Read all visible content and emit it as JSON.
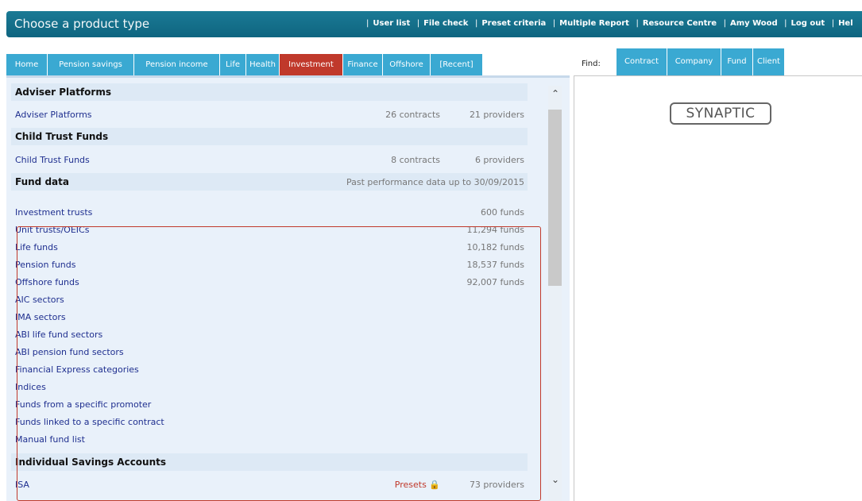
{
  "header": {
    "title": "Choose a product type",
    "links": [
      "User list",
      "File check",
      "Preset criteria",
      "Multiple Report",
      "Resource Centre",
      "Amy Wood",
      "Log out",
      "Hel"
    ]
  },
  "tabs": [
    "Home",
    "Pension savings",
    "Pension income",
    "Life",
    "Health",
    "Investment",
    "Finance",
    "Offshore",
    "[Recent]"
  ],
  "find": {
    "label": "Find:",
    "tabs": [
      "Contract",
      "Company",
      "Fund",
      "Client"
    ]
  },
  "logo": "SYNAPTIC",
  "sections": {
    "adviser": {
      "title": "Adviser Platforms",
      "item": "Adviser Platforms",
      "contracts": "26 contracts",
      "providers": "21 providers"
    },
    "ctf": {
      "title": "Child Trust Funds",
      "item": "Child Trust Funds",
      "contracts": "8 contracts",
      "providers": "6 providers"
    },
    "fund": {
      "title": "Fund data",
      "note": "Past performance data up to 30/09/2015",
      "items": [
        {
          "label": "Investment trusts",
          "count": "600 funds"
        },
        {
          "label": "Unit trusts/OEICs",
          "count": "11,294 funds"
        },
        {
          "label": "Life funds",
          "count": "10,182 funds"
        },
        {
          "label": "Pension funds",
          "count": "18,537 funds"
        },
        {
          "label": "Offshore funds",
          "count": "92,007 funds"
        },
        {
          "label": "AIC sectors",
          "count": ""
        },
        {
          "label": "IMA sectors",
          "count": ""
        },
        {
          "label": "ABI life fund sectors",
          "count": ""
        },
        {
          "label": "ABI pension fund sectors",
          "count": ""
        },
        {
          "label": "Financial Express categories",
          "count": ""
        },
        {
          "label": "Indices",
          "count": ""
        },
        {
          "label": "Funds from a specific promoter",
          "count": ""
        },
        {
          "label": "Funds linked to a specific contract",
          "count": ""
        },
        {
          "label": "Manual fund list",
          "count": ""
        }
      ]
    },
    "isa": {
      "title": "Individual Savings Accounts",
      "item": "ISA",
      "presets": "Presets",
      "providers": "73 providers"
    }
  },
  "colors": {
    "topbar": "#0f6580",
    "tab": "#3aa9d2",
    "active_tab": "#c0392b",
    "panel": "#e9f1fa"
  }
}
